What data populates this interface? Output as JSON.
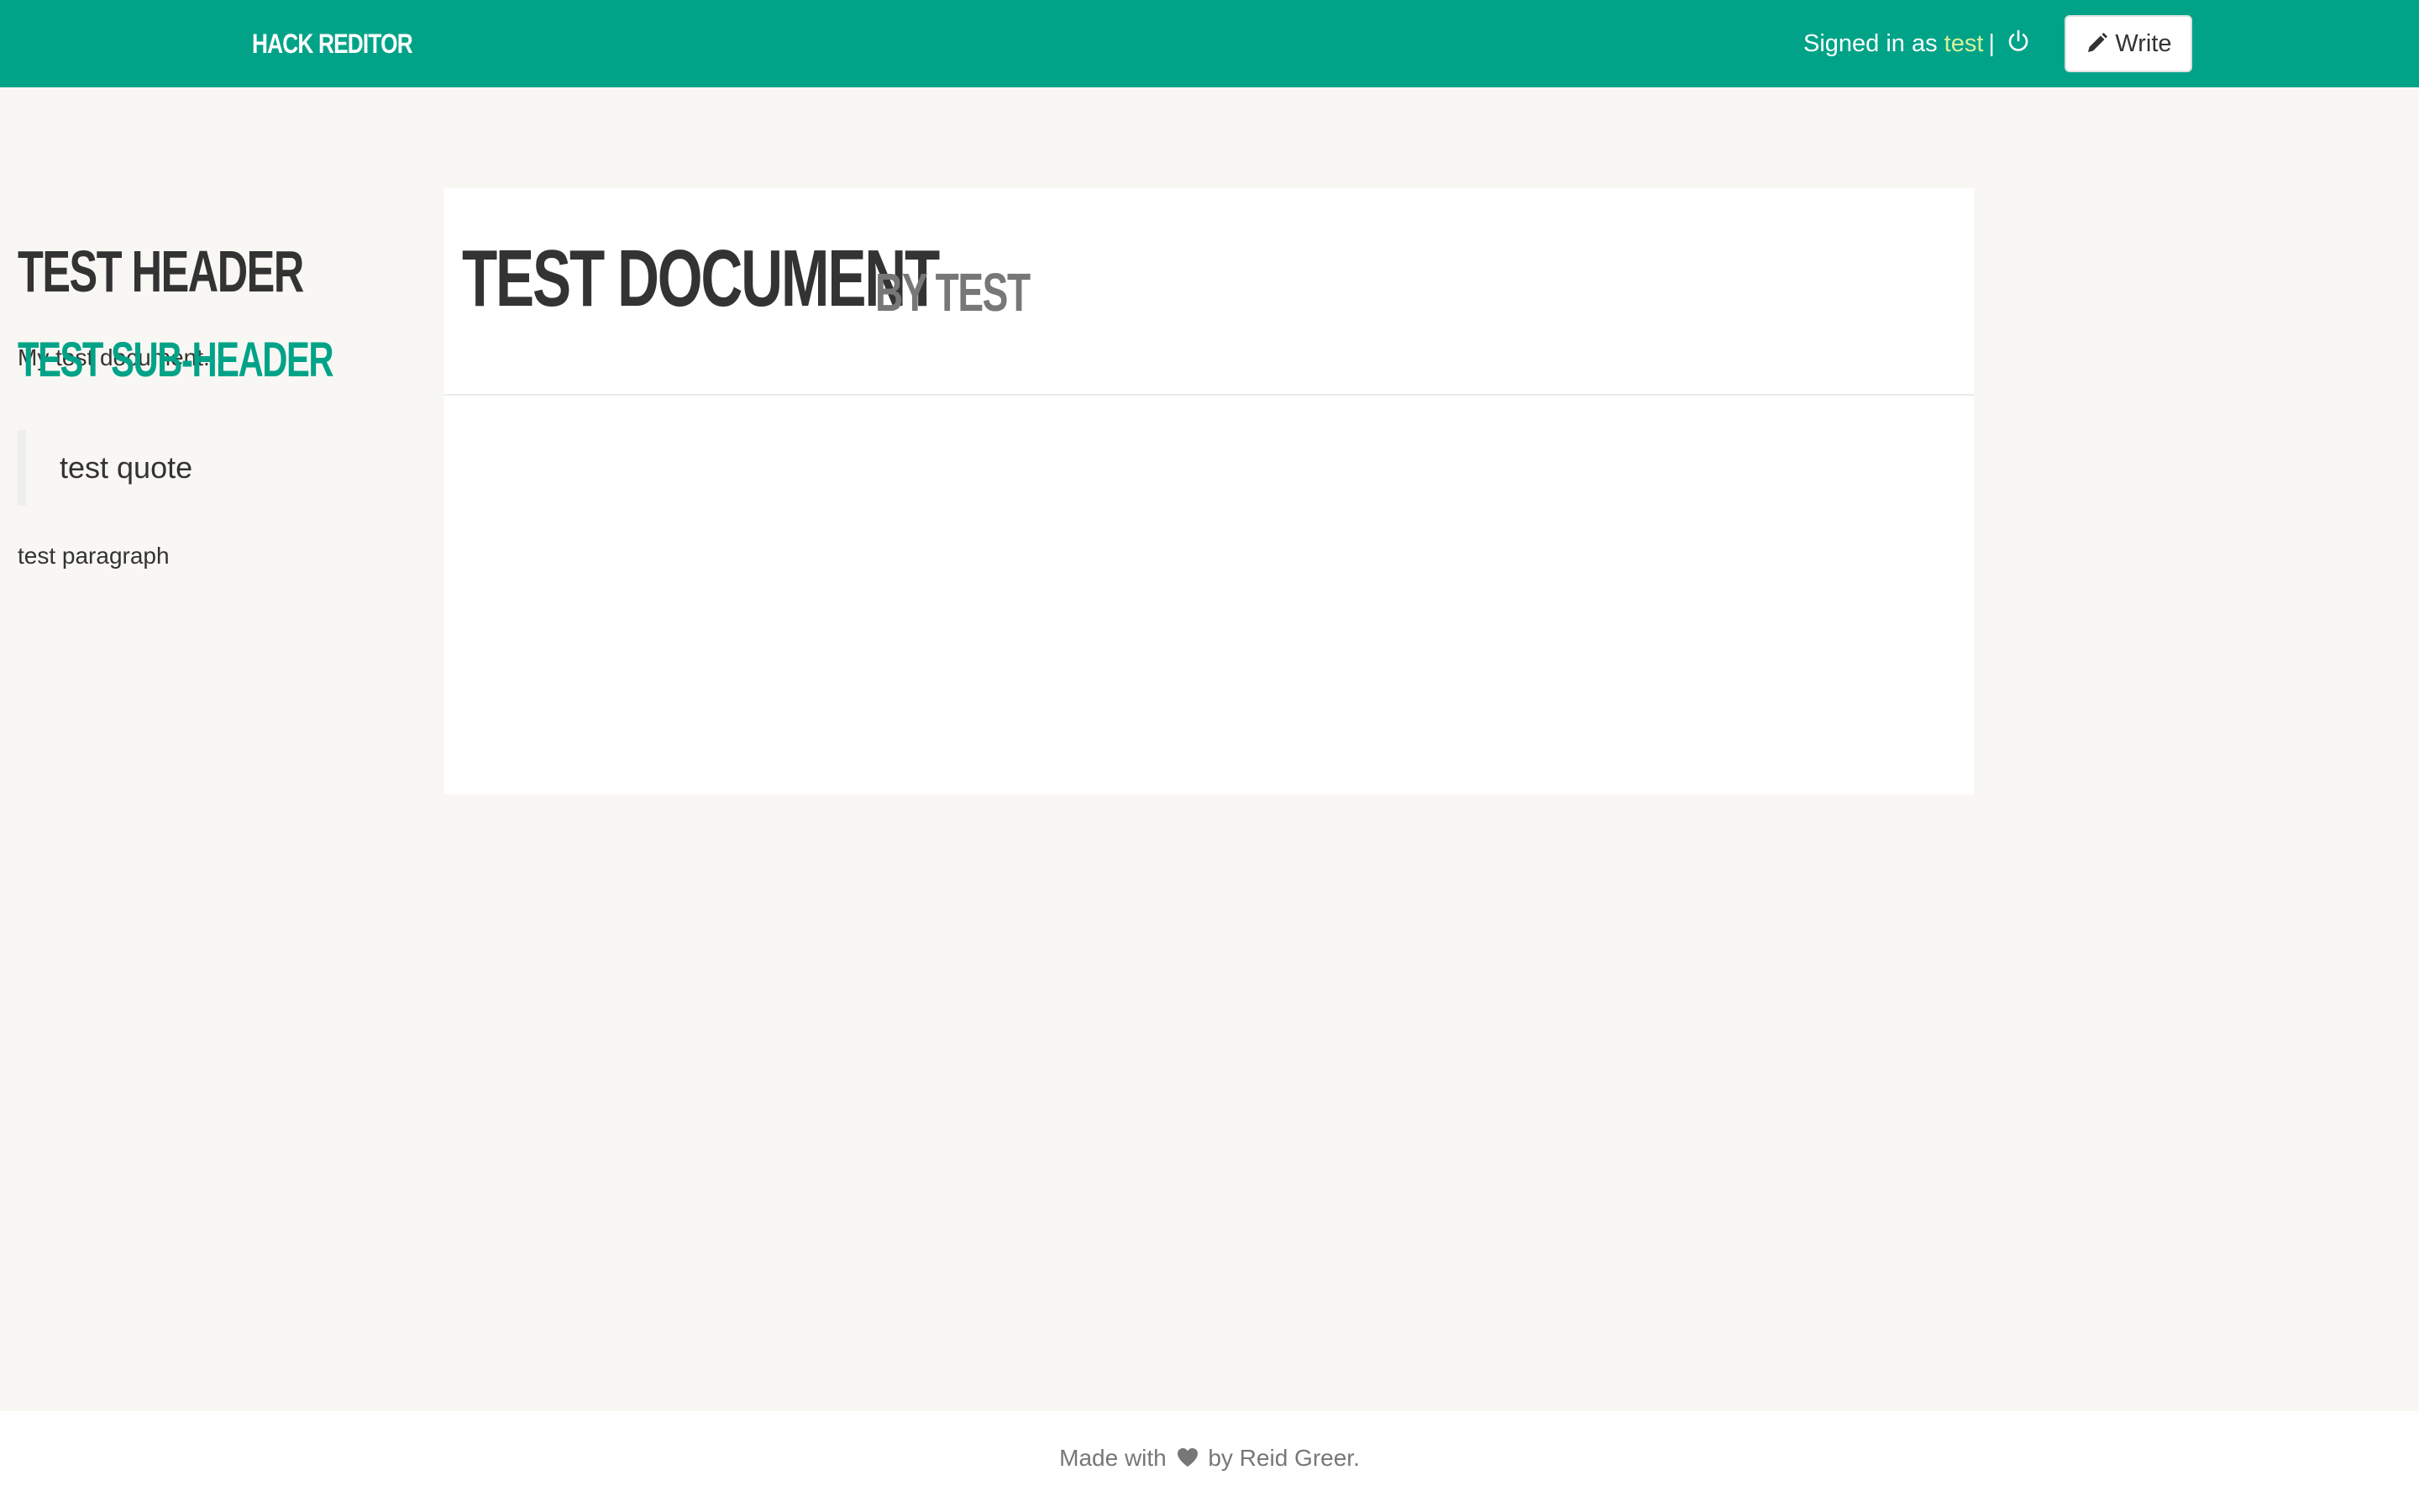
{
  "navbar": {
    "brand": "HACK REDITOR",
    "signed_in_prefix": "Signed in as ",
    "username": "test",
    "separator": "|",
    "logout_icon": "power-icon",
    "write_label": "Write",
    "write_icon": "pencil-icon",
    "accent_color": "#00a388",
    "username_color": "#d8ef9c"
  },
  "document": {
    "title": "TEST DOCUMENT",
    "byline_prefix": "BY",
    "author": "TEST",
    "description": "My test document."
  },
  "content": {
    "header": "TEST HEADER",
    "subheader": "TEST SUB-HEADER",
    "quote": "test quote",
    "paragraph": "test paragraph"
  },
  "footer": {
    "made_with": "Made with",
    "heart_icon": "heart-icon",
    "by_text": "by Reid Greer."
  }
}
